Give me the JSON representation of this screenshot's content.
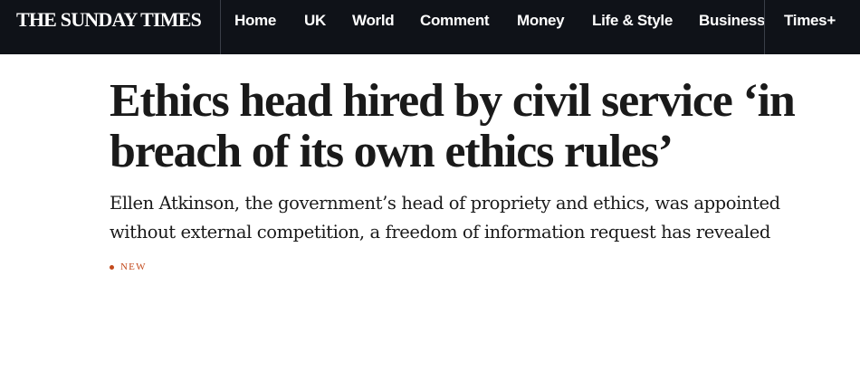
{
  "header": {
    "logo": "THE SUNDAY TIMES",
    "nav": [
      {
        "label": "Home"
      },
      {
        "label": "UK"
      },
      {
        "label": "World"
      },
      {
        "label": "Comment"
      },
      {
        "label": "Money"
      },
      {
        "label": "Life & Style"
      },
      {
        "label": "Business"
      },
      {
        "label": "Times+"
      }
    ]
  },
  "article": {
    "headline": "Ethics head hired by civil service ‘in breach of its own ethics rules’",
    "standfirst": "Ellen Atkinson, the government’s head of propriety and ethics, was appointed without external competition, a freedom of information request has revealed",
    "tag": "NEW"
  },
  "colors": {
    "topbar": "#0f1218",
    "accent": "#c34a1d",
    "text": "#1a1a1a"
  }
}
